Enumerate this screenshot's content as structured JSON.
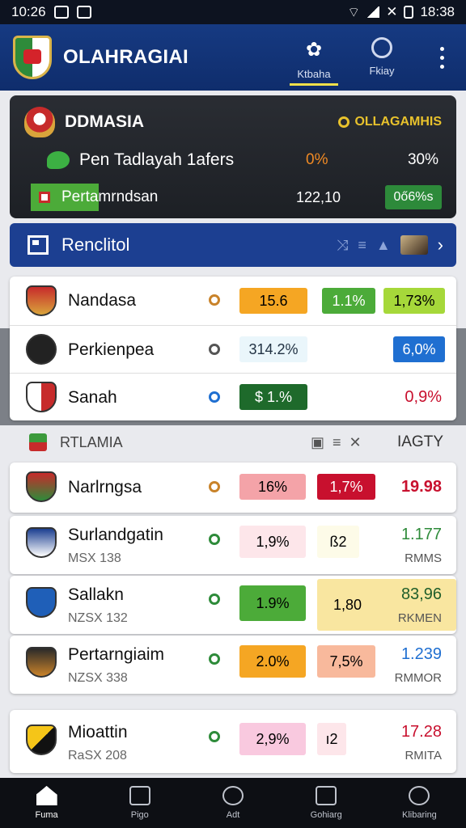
{
  "status_bar": {
    "time_left": "10:26",
    "time_right": "18:38"
  },
  "header": {
    "title": "OLAHRAGIAI",
    "tabs": [
      {
        "label": "Ktbaha",
        "icon": "gear-icon",
        "active": true
      },
      {
        "label": "Fkiay",
        "icon": "chat-bubble-icon",
        "active": false
      }
    ]
  },
  "summary": {
    "title": "DDMASIA",
    "badge": "OLLAGAMHIS",
    "row1": {
      "label": "Pen Tadlayah 1afers",
      "pct_orange": "0%",
      "pct": "30%"
    },
    "row2": {
      "label": "Pertamrndsan",
      "value": "122,10",
      "pill": "0ő6%s"
    }
  },
  "blue_bar": {
    "label": "Renclitol"
  },
  "card1": [
    {
      "name": "Nandasa",
      "chip1": "15.6",
      "chip2": "1.1%",
      "chip3": "1,73%"
    },
    {
      "name": "Perkienpea",
      "chip1": "314.2%",
      "chip3": "6,0%"
    },
    {
      "name": "Sanah",
      "chip1": "$ 1.%",
      "right": "0,9%"
    }
  ],
  "section": {
    "label": "RTLAMIA",
    "right": "IAGTY"
  },
  "rows": [
    {
      "name": "Narlrngsa",
      "sub": "",
      "chip1": "16%",
      "chip2": "1,7%",
      "value": "19.98",
      "value_sub": ""
    },
    {
      "name": "Surlandgatin",
      "sub": "MSX 138",
      "chip1": "1,9%",
      "chip2": "ß2",
      "value": "1.177",
      "value_sub": "RMMS"
    },
    {
      "name": "Sallakn",
      "sub": "NZSX 132",
      "chip1": "1.9%",
      "chip2": "1,80",
      "value": "83,96",
      "value_sub": "RKMEN"
    },
    {
      "name": "Pertarngiaim",
      "sub": "NZSX 338",
      "chip1": "2.0%",
      "chip2": "7,5%",
      "value": "1.239",
      "value_sub": "RMMOR"
    },
    {
      "name": "Mioattin",
      "sub": "RaSX 208",
      "chip1": "2,9%",
      "chip2": "ı2",
      "value": "17.28",
      "value_sub": "RMITA"
    }
  ],
  "bottom_nav": [
    {
      "label": "Fuma",
      "icon": "home-icon",
      "active": true
    },
    {
      "label": "Pigo",
      "icon": "calendar-icon",
      "active": false
    },
    {
      "label": "Adt",
      "icon": "ball-icon",
      "active": false
    },
    {
      "label": "Gohiarg",
      "icon": "team-icon",
      "active": false
    },
    {
      "label": "Klibaring",
      "icon": "profile-icon",
      "active": false
    }
  ],
  "colors": {
    "header_blue": "#163a82",
    "accent_yellow": "#f2e14a",
    "green": "#4cab39",
    "orange": "#f5a623",
    "red": "#c8102e"
  }
}
